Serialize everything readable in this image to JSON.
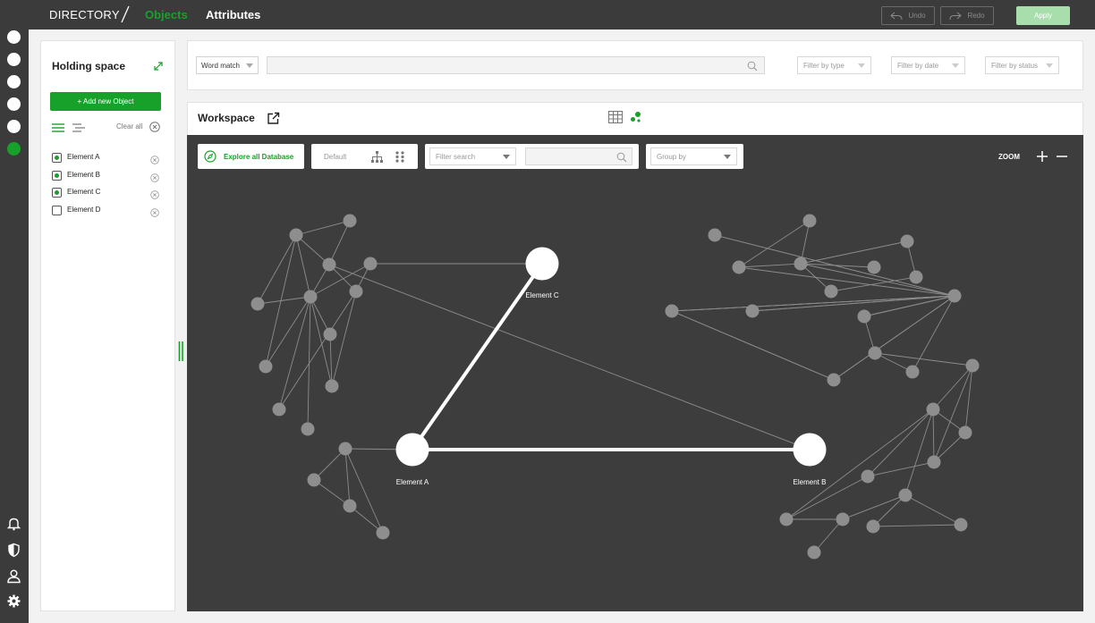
{
  "topbar": {
    "brand": "DIRECTORY",
    "breadcrumb_active": "Objects",
    "breadcrumb_next": "Attributes",
    "undo_label": "Undo",
    "redo_label": "Redo",
    "apply_label": "Apply"
  },
  "rail": {
    "icons": [
      "bell-icon",
      "shield-icon",
      "user-icon",
      "gear-icon"
    ]
  },
  "holding_space": {
    "title": "Holding space",
    "add_button": "+ Add new Object",
    "clear_all": "Clear all",
    "items": [
      {
        "label": "Element A",
        "checked": true
      },
      {
        "label": "Element B",
        "checked": true
      },
      {
        "label": "Element C",
        "checked": true
      },
      {
        "label": "Element D",
        "checked": false
      }
    ]
  },
  "search": {
    "mode": "Word match",
    "value": "",
    "placeholder": "",
    "filter_type": "Filter by type",
    "filter_date": "Filter by date",
    "filter_status": "Filter by status"
  },
  "workspace": {
    "title": "Workspace",
    "explore_label": "Explore all Database",
    "layout_label": "Default",
    "filter_search": "Filter search",
    "group_by": "Group by",
    "zoom_label": "ZOOM",
    "nodes": [
      {
        "id": "A",
        "label": "Element A"
      },
      {
        "id": "B",
        "label": "Element B"
      },
      {
        "id": "C",
        "label": "Element C"
      }
    ]
  },
  "colors": {
    "accent": "#18a12a",
    "dark_bg": "#3b3b3b",
    "canvas_bg": "#3d3d3d",
    "node_small": "#8e8e8e",
    "apply_disabled": "#a8deac"
  }
}
